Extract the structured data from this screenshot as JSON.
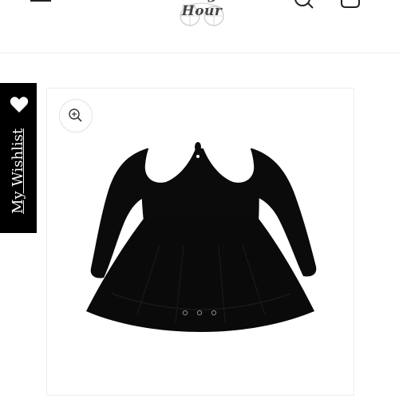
{
  "header": {
    "logo_text": "Witching Your Hour",
    "icons": [
      "menu-icon",
      "search-icon",
      "cart-icon"
    ]
  },
  "wishlist": {
    "label": "My Wishlist",
    "icon": "heart-icon"
  },
  "product": {
    "image_alt": "Black long-sleeve baby dress with white peter pan collar and tulle skirt",
    "zoom_icon": "zoom-in-icon"
  },
  "colors": {
    "accent": "#000000",
    "background": "#ffffff",
    "collar": "#ffffff",
    "border": "#ededed"
  }
}
